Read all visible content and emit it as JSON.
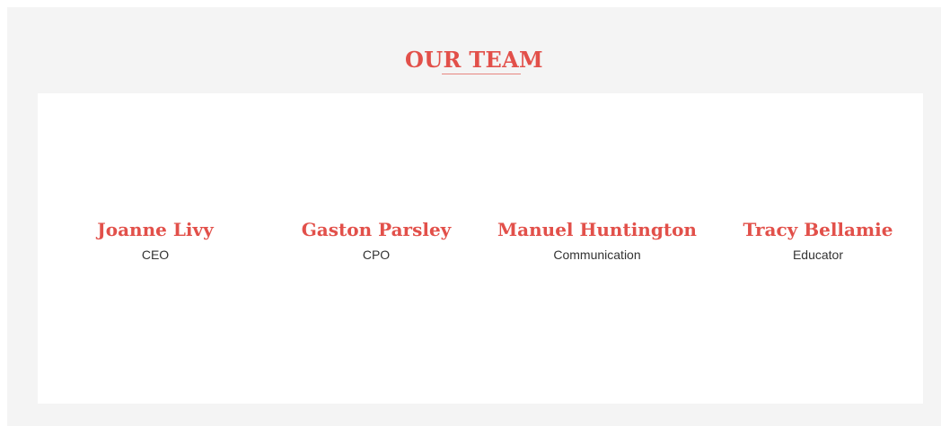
{
  "section": {
    "title": "OUR TEAM"
  },
  "team": {
    "members": [
      {
        "name": "Joanne Livy",
        "role": "CEO"
      },
      {
        "name": "Gaston Parsley",
        "role": "CPO"
      },
      {
        "name": "Manuel Huntington",
        "role": "Communication"
      },
      {
        "name": "Tracy Bellamie",
        "role": "Educator"
      }
    ]
  },
  "colors": {
    "accent": "#e2504a",
    "section_background": "#f4f4f4",
    "panel_background": "#ffffff",
    "role_text": "#333333"
  }
}
